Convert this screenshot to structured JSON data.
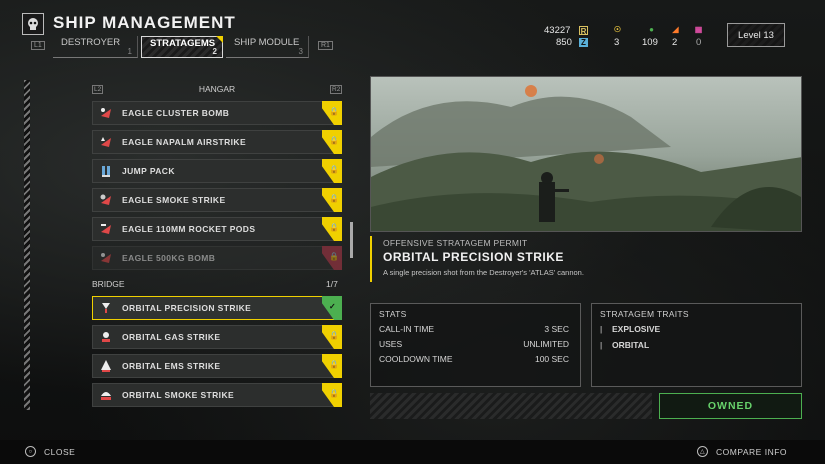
{
  "header": {
    "title": "SHIP MANAGEMENT",
    "left_trigger": "L1",
    "right_trigger": "R1",
    "tabs": [
      {
        "label": "DESTROYER",
        "num": "1"
      },
      {
        "label": "STRATAGEMS",
        "num": "2"
      },
      {
        "label": "SHIP MODULE",
        "num": "3"
      }
    ],
    "resources": {
      "requisition": "43227",
      "requisition_icon": "R",
      "super_credits": "850",
      "medals": "3",
      "samples_common": "109",
      "samples_rare": "2",
      "samples_super": "0"
    },
    "level": "Level 13"
  },
  "list": {
    "hangar_label": "HANGAR",
    "l2": "L2",
    "r2": "R2",
    "hangar_items": [
      {
        "label": "EAGLE CLUSTER BOMB",
        "icon": "cluster-bomb-icon"
      },
      {
        "label": "EAGLE NAPALM AIRSTRIKE",
        "icon": "napalm-icon"
      },
      {
        "label": "JUMP PACK",
        "icon": "jump-pack-icon"
      },
      {
        "label": "EAGLE SMOKE STRIKE",
        "icon": "smoke-strike-icon"
      },
      {
        "label": "EAGLE 110MM ROCKET PODS",
        "icon": "rocket-pods-icon"
      },
      {
        "label": "EAGLE 500KG BOMB",
        "icon": "bomb-icon"
      }
    ],
    "bridge_label": "BRIDGE",
    "bridge_count": "1/7",
    "bridge_items": [
      {
        "label": "ORBITAL PRECISION STRIKE",
        "icon": "precision-strike-icon"
      },
      {
        "label": "ORBITAL GAS STRIKE",
        "icon": "gas-strike-icon"
      },
      {
        "label": "ORBITAL EMS STRIKE",
        "icon": "ems-strike-icon"
      },
      {
        "label": "ORBITAL SMOKE STRIKE",
        "icon": "orbital-smoke-icon"
      }
    ]
  },
  "detail": {
    "permit_kind": "OFFENSIVE STRATAGEM PERMIT",
    "name": "ORBITAL PRECISION STRIKE",
    "description": "A single precision shot from the Destroyer's 'ATLAS' cannon.",
    "stats_header": "STATS",
    "stats": [
      {
        "label": "CALL-IN TIME",
        "value": "3 SEC"
      },
      {
        "label": "USES",
        "value": "UNLIMITED"
      },
      {
        "label": "COOLDOWN TIME",
        "value": "100 SEC"
      }
    ],
    "traits_header": "STRATAGEM TRAITS",
    "traits": [
      "EXPLOSIVE",
      "ORBITAL"
    ],
    "owned_label": "OWNED"
  },
  "footer": {
    "close_label": "CLOSE",
    "compare_label": "COMPARE INFO"
  },
  "colors": {
    "accent_yellow": "#f0d000",
    "owned_green": "#4caf50",
    "locked_red": "#b5384a"
  }
}
